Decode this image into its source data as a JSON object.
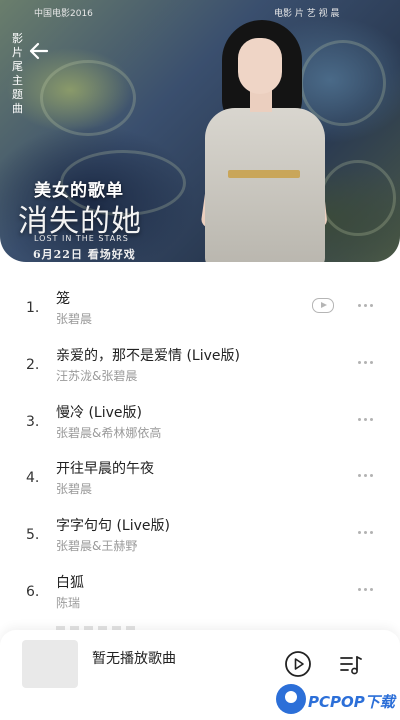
{
  "header": {
    "playlist_title": "美女的歌单",
    "poster": {
      "side_text": "影片尾主题曲",
      "top_left_tiny": "中国电影2016",
      "top_right_tiny": "电影 片 艺 视 晨",
      "title": "消失的她",
      "title_en": "LOST IN THE STARS",
      "release": "6月22日  看场好戏"
    }
  },
  "songs": [
    {
      "index": "1.",
      "name": "笼",
      "artist": "张碧晨",
      "has_mv": true
    },
    {
      "index": "2.",
      "name": "亲爱的，那不是爱情 (Live版)",
      "artist": "汪苏泷&张碧晨",
      "has_mv": false
    },
    {
      "index": "3.",
      "name": "慢冷 (Live版)",
      "artist": "张碧晨&希林娜依高",
      "has_mv": false
    },
    {
      "index": "4.",
      "name": "开往早晨的午夜",
      "artist": "张碧晨",
      "has_mv": false
    },
    {
      "index": "5.",
      "name": "字字句句 (Live版)",
      "artist": "张碧晨&王赫野",
      "has_mv": false
    },
    {
      "index": "6.",
      "name": "白狐",
      "artist": "陈瑞",
      "has_mv": false
    }
  ],
  "player": {
    "now_playing": "暂无播放歌曲"
  },
  "watermark": {
    "text": "PCPOP下载"
  },
  "icons": {
    "back": "arrow-left-icon",
    "mv": "mv-play-icon",
    "more": "more-dots-icon",
    "play": "play-circle-icon",
    "queue": "playlist-music-icon"
  },
  "colors": {
    "artist_text": "#9a9a9a",
    "watermark": "#2c6fd8"
  }
}
